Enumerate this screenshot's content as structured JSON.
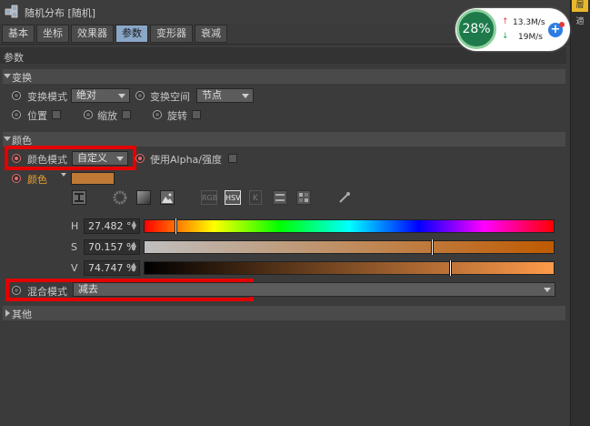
{
  "window": {
    "title": "随机分布 [随机]"
  },
  "tabs": [
    {
      "label": "基本",
      "active": false
    },
    {
      "label": "坐标",
      "active": false
    },
    {
      "label": "效果器",
      "active": false
    },
    {
      "label": "参数",
      "active": true
    },
    {
      "label": "变形器",
      "active": false
    },
    {
      "label": "衰减",
      "active": false
    }
  ],
  "params_header": "参数",
  "transform": {
    "section_label": "变换",
    "transform_mode_label": "变换模式",
    "transform_mode_value": "绝对",
    "transform_space_label": "变换空间",
    "transform_space_value": "节点",
    "position_label": "位置",
    "scale_label": "缩放",
    "rotation_label": "旋转"
  },
  "color": {
    "section_label": "颜色",
    "color_mode_label": "颜色模式",
    "color_mode_value": "自定义",
    "use_alpha_label": "使用Alpha/强度",
    "color_label": "颜色",
    "swatch_color": "#c07a36",
    "picker_modes": [
      "RGB",
      "HSV",
      "K"
    ],
    "h_label": "H",
    "h_value": "27.482 °",
    "h_fraction": 0.076,
    "s_label": "S",
    "s_value": "70.157 %",
    "s_fraction": 0.7016,
    "v_label": "V",
    "v_value": "74.747 %",
    "v_fraction": 0.7475
  },
  "blend": {
    "label": "混合模式",
    "value": "减去"
  },
  "other": {
    "section_label": "其他"
  },
  "network_widget": {
    "percent": "28%",
    "upload_speed": "13.3M/s",
    "download_speed": "19M/s",
    "up_arrow": "↑",
    "down_arrow": "↓",
    "plus": "+"
  },
  "right_panel": {
    "tab1": "層",
    "tab2": "適"
  },
  "colors": {
    "accent_tab": "#8aa7c8",
    "highlight": "#e30000",
    "label_orange": "#e8a030"
  }
}
